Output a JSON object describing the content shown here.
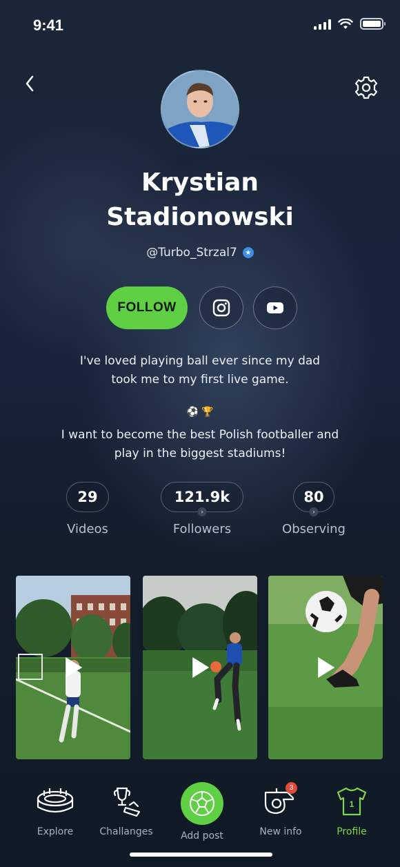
{
  "status_bar": {
    "time": "9:41"
  },
  "profile": {
    "name_line1": "Krystian",
    "name_line2": "Stadionowski",
    "handle": "@Turbo_Strzal7",
    "verified": true,
    "follow_label": "FOLLOW",
    "social": [
      "instagram-icon",
      "youtube-icon"
    ],
    "bio_line1a": "I've loved playing ball ever since my dad",
    "bio_line1b": "took me to my first live game.",
    "emojis": [
      "⚽",
      "🏆"
    ],
    "bio_line2a": "I want to become the best Polish footballer and",
    "bio_line2b": "play in the biggest stadiums!"
  },
  "stats": [
    {
      "value": "29",
      "label": "Videos"
    },
    {
      "value": "121.9k",
      "label": "Followers"
    },
    {
      "value": "80",
      "label": "Observing"
    }
  ],
  "videos": [
    {
      "thumbnail": "youth-football-match-thumbnail"
    },
    {
      "thumbnail": "player-juggling-ball-thumbnail"
    },
    {
      "thumbnail": "foot-on-ball-thumbnail"
    }
  ],
  "tabbar": {
    "items": [
      {
        "label": "Explore",
        "icon": "stadium-icon",
        "active": false
      },
      {
        "label": "Challanges",
        "icon": "trophy-icon",
        "active": false
      },
      {
        "label": "Add post",
        "icon": "ball-icon",
        "active": false
      },
      {
        "label": "New info",
        "icon": "whistle-icon",
        "active": false,
        "badge": "3"
      },
      {
        "label": "Profile",
        "icon": "jersey-icon",
        "active": true,
        "jersey_number": "1"
      }
    ]
  },
  "colors": {
    "accent": "#5fcf43",
    "background": "#141d2b",
    "badge": "#e24a3a",
    "verified": "#3d8fe6"
  }
}
